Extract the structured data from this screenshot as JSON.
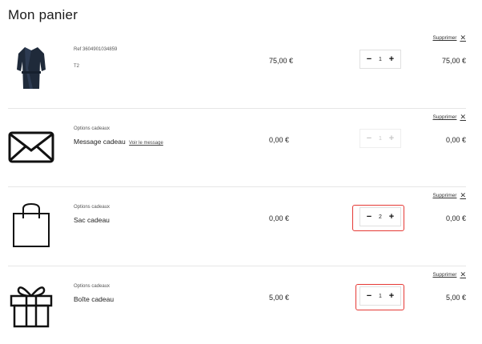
{
  "page": {
    "title": "Mon panier"
  },
  "cart": {
    "remove_label": "Supprimer",
    "items": [
      {
        "type": "product",
        "icon": "bathrobe-icon",
        "ref": "Ref 3604901034859",
        "size": "T2",
        "price": "75,00 €",
        "quantity": "1",
        "total": "75,00 €",
        "stepper_disabled": false
      },
      {
        "type": "gift-option",
        "icon": "envelope-icon",
        "category": "Options cadeaux",
        "name": "Message cadeau",
        "link": "Voir le message",
        "price": "0,00 €",
        "quantity": "1",
        "total": "0,00 €",
        "stepper_disabled": true
      },
      {
        "type": "gift-option",
        "icon": "shopping-bag-icon",
        "category": "Options cadeaux",
        "name": "Sac cadeau",
        "price": "0,00 €",
        "quantity": "2",
        "total": "0,00 €",
        "stepper_disabled": false,
        "highlighted": true
      },
      {
        "type": "gift-option",
        "icon": "gift-box-icon",
        "category": "Options cadeaux",
        "name": "Boîte cadeau",
        "price": "5,00 €",
        "quantity": "1",
        "total": "5,00 €",
        "stepper_disabled": false,
        "highlighted": true
      }
    ]
  },
  "colors": {
    "highlight": "#e53935",
    "text": "#222222",
    "divider": "#e6e6e6"
  },
  "symbols": {
    "minus": "−",
    "plus": "+",
    "close": "✕"
  }
}
